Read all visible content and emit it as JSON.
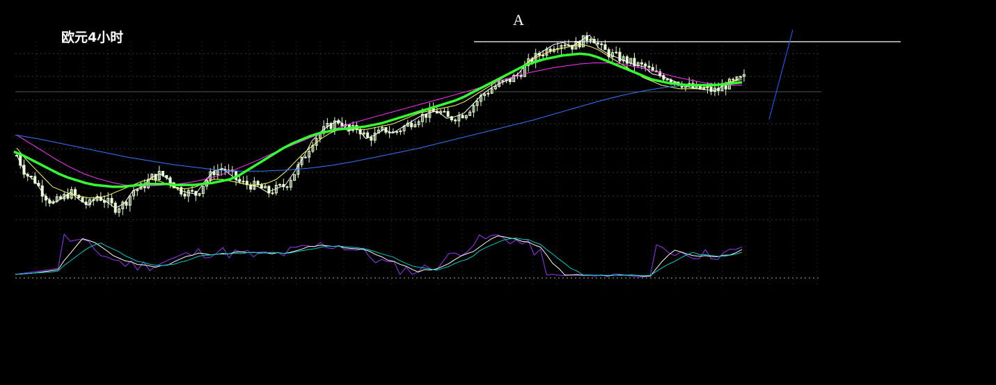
{
  "chart_data": {
    "type": "candlestick",
    "title": "欧元4小时",
    "annotation": "A",
    "colors": {
      "background": "#000000",
      "grid": "#3a3a3a",
      "candle": "#e6ffd0",
      "ma_fast": "#ffffff",
      "ma_mid": "#ffff66",
      "ma_slow": "#ff33ff",
      "ma_thick": "#33ff33",
      "ma_long": "#3377ff",
      "osc_k": "#9933ff",
      "osc_d": "#ffffee",
      "osc_j": "#00cccc",
      "resistance": "#ffffff",
      "projection": "#2255ee"
    },
    "grid": true,
    "series": [
      {
        "name": "",
        "values": [
          62,
          42,
          35,
          20,
          10,
          15,
          22,
          14,
          8,
          18,
          12,
          5,
          10,
          24,
          28,
          38,
          42,
          36,
          25,
          22,
          20,
          34,
          45,
          48,
          40,
          32,
          30,
          28,
          22,
          26,
          30,
          44,
          60,
          78,
          88,
          95,
          100,
          88,
          92,
          80,
          84,
          90,
          86,
          92,
          98,
          104,
          108,
          110,
          102,
          104,
          108,
          118,
          128,
          135,
          140,
          144,
          150,
          162,
          170,
          176,
          182,
          184,
          180,
          186,
          192,
          178,
          172,
          168,
          164,
          160,
          158,
          150,
          148,
          144,
          140,
          136,
          134,
          133,
          132,
          138,
          142,
          146
        ]
      },
      {
        "name": "",
        "values": [
          70,
          58,
          48,
          38,
          28,
          24,
          20,
          18,
          16,
          16,
          18,
          22,
          26,
          30,
          34,
          36,
          34,
          30,
          26,
          26,
          28,
          32,
          36,
          36,
          34,
          32,
          30,
          30,
          32,
          36,
          44,
          54,
          64,
          72,
          80,
          86,
          90,
          92,
          90,
          90,
          92,
          94,
          96,
          100,
          104,
          108,
          110,
          112,
          114,
          116,
          120,
          126,
          132,
          138,
          144,
          150,
          156,
          162,
          168,
          172,
          176,
          178,
          180,
          182,
          180,
          176,
          170,
          164,
          158,
          152,
          146,
          142,
          138,
          136,
          134,
          134,
          134,
          136,
          138,
          140,
          142,
          144
        ]
      },
      {
        "name": "",
        "values": [
          66,
          62,
          57,
          52,
          47,
          42,
          38,
          35,
          32,
          30,
          29,
          28,
          28,
          29,
          30,
          31,
          31,
          31,
          30,
          30,
          30,
          31,
          32,
          34,
          36,
          40,
          46,
          52,
          58,
          64,
          70,
          75,
          79,
          83,
          86,
          88,
          90,
          91,
          92,
          93,
          95,
          97,
          100,
          103,
          106,
          109,
          112,
          115,
          118,
          121,
          125,
          130,
          135,
          140,
          145,
          150,
          155,
          160,
          163,
          166,
          168,
          170,
          171,
          172,
          171,
          168,
          164,
          160,
          156,
          152,
          148,
          144,
          142,
          140,
          139,
          138,
          138,
          138,
          138,
          139,
          140,
          141
        ]
      },
      {
        "name": "",
        "values": [
          84,
          75,
          66,
          57,
          49,
          42,
          37,
          33,
          30,
          29,
          29,
          30,
          31,
          33,
          36,
          40,
          45,
          51,
          57,
          64,
          70,
          76,
          82,
          87,
          92,
          97,
          101,
          105,
          109,
          113,
          117,
          121,
          125,
          129,
          133,
          138,
          143,
          147,
          151,
          154,
          157,
          159,
          161,
          162,
          162,
          161,
          158,
          155,
          151,
          147,
          144,
          141,
          139,
          138,
          138
        ]
      },
      {
        "name": "",
        "values": [
          84,
          80,
          75,
          70,
          65,
          60,
          56,
          52,
          49,
          46,
          45,
          45,
          46,
          48,
          51,
          55,
          60,
          65,
          70,
          76,
          82,
          88,
          94,
          100,
          107,
          114,
          121,
          127,
          132,
          136,
          138,
          139,
          140
        ]
      }
    ]
  }
}
